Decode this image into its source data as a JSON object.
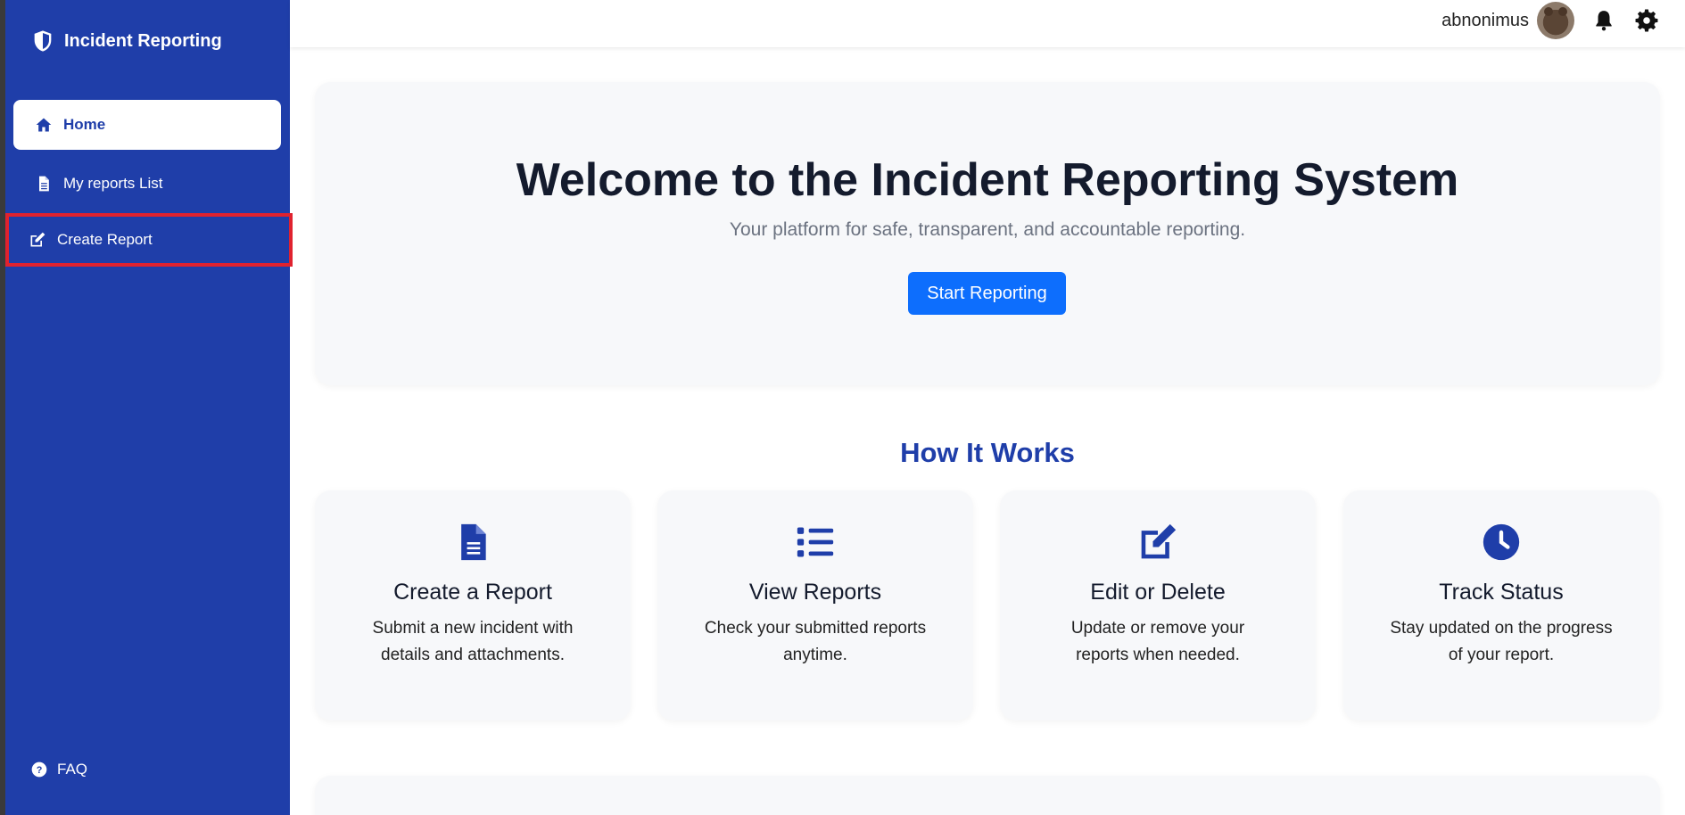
{
  "sidebar": {
    "brand": "Incident Reporting",
    "items": [
      {
        "label": "Home"
      },
      {
        "label": "My reports List"
      },
      {
        "label": "Create Report"
      }
    ],
    "faq": "FAQ"
  },
  "topbar": {
    "username": "abnonimus"
  },
  "hero": {
    "title": "Welcome to the Incident Reporting System",
    "subtitle": "Your platform for safe, transparent, and accountable reporting.",
    "button": "Start Reporting"
  },
  "how": {
    "title": "How It Works",
    "cards": [
      {
        "icon": "file-icon",
        "title": "Create a Report",
        "text": "Submit a new incident with details and attachments."
      },
      {
        "icon": "list-icon",
        "title": "View Reports",
        "text": "Check your submitted reports anytime."
      },
      {
        "icon": "edit-icon",
        "title": "Edit or Delete",
        "text": "Update or remove your reports when needed."
      },
      {
        "icon": "clock-icon",
        "title": "Track Status",
        "text": "Stay updated on the progress of your report."
      }
    ]
  },
  "colors": {
    "sidebar": "#1f3ea9",
    "accent": "#0d6efd",
    "highlight": "#e0222f"
  }
}
